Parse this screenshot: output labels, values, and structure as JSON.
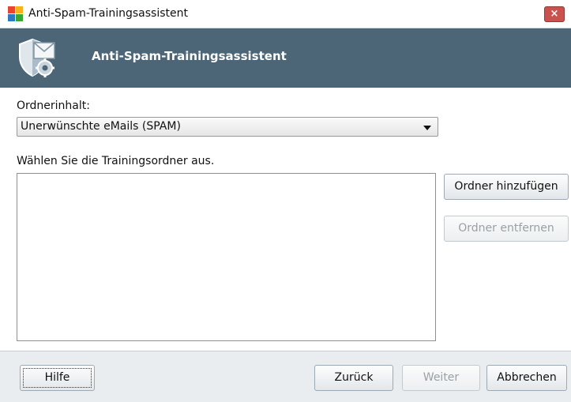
{
  "window": {
    "title": "Anti-Spam-Trainingsassistent",
    "close_glyph": "×"
  },
  "banner": {
    "title": "Anti-Spam-Trainingsassistent",
    "icon": "shield-mail-gear-icon"
  },
  "folder_content": {
    "label": "Ordnerinhalt:",
    "selected": "Unerwünschte eMails (SPAM)"
  },
  "training_folders": {
    "label": "Wählen Sie die Trainingsordner aus.",
    "items": []
  },
  "buttons": {
    "add_folder": "Ordner hinzufügen",
    "remove_folder": "Ordner entfernen",
    "help": "Hilfe",
    "back": "Zurück",
    "next": "Weiter",
    "cancel": "Abbrechen"
  },
  "colors": {
    "banner_bg": "#4c6678",
    "footer_bg": "#e9edf0",
    "close_button": "#c9524f"
  }
}
